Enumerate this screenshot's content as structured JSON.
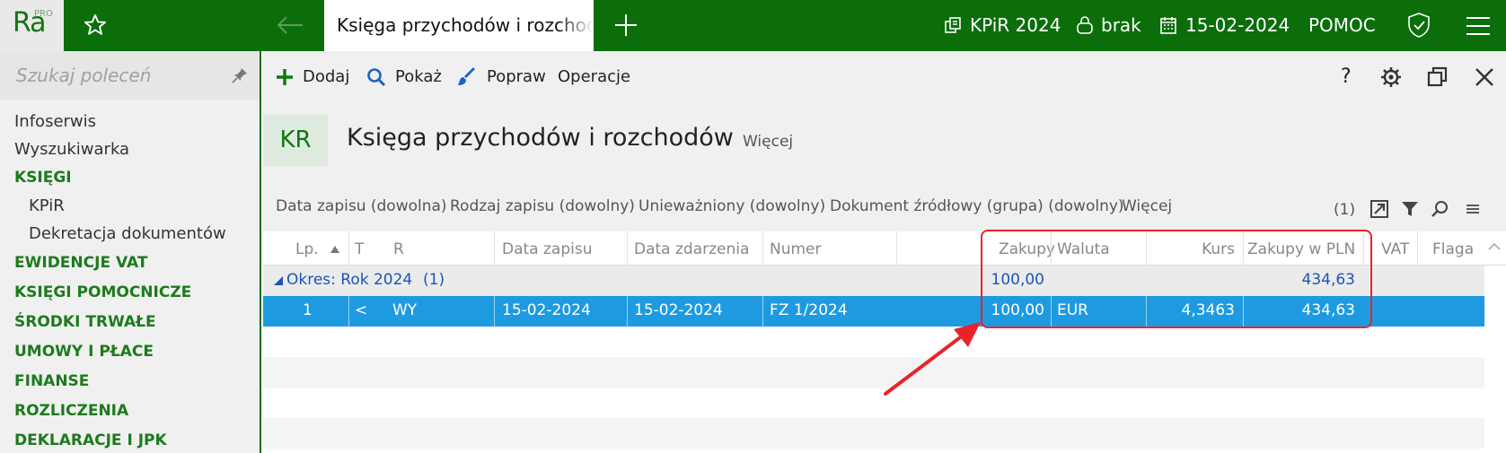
{
  "app": {
    "logo_text": "Ra",
    "logo_badge": "PRO",
    "active_tab": "Księga przychodów i rozchodów",
    "kpir_label": "KPiR 2024",
    "lock_label": "brak",
    "date_label": "15-02-2024",
    "help_label": "POMOC"
  },
  "sidebar": {
    "search_placeholder": "Szukaj poleceń",
    "items": [
      {
        "label": "Infoserwis"
      },
      {
        "label": "Wyszukiwarka"
      },
      {
        "label": "KSIĘGI"
      },
      {
        "label": "KPiR"
      },
      {
        "label": "Dekretacja dokumentów"
      },
      {
        "label": "EWIDENCJE VAT"
      },
      {
        "label": "KSIĘGI POMOCNICZE"
      },
      {
        "label": "ŚRODKI TRWAŁE"
      },
      {
        "label": "UMOWY I PŁACE"
      },
      {
        "label": "FINANSE"
      },
      {
        "label": "ROZLICZENIA"
      },
      {
        "label": "DEKLARACJE I JPK"
      }
    ]
  },
  "toolbar": {
    "add_label": "Dodaj",
    "show_label": "Pokaż",
    "edit_label": "Popraw",
    "ops_label": "Operacje",
    "help_glyph": "?"
  },
  "header": {
    "badge": "KR",
    "title": "Księga przychodów i rozchodów",
    "more": "Więcej"
  },
  "filters": {
    "items": [
      "Data zapisu (dowolna)",
      "Rodzaj zapisu (dowolny)",
      "Unieważniony (dowolny)",
      "Dokument źródłowy (grupa) (dowolny)",
      "Więcej"
    ],
    "count": "(1)"
  },
  "grid": {
    "columns": [
      "Lp.",
      "T",
      "R",
      "Data zapisu",
      "Data zdarzenia",
      "Numer",
      "Zakupy",
      "Waluta",
      "Kurs",
      "Zakupy w PLN",
      "VAT",
      "Flaga"
    ],
    "group": {
      "label": "Okres: Rok 2024",
      "count": "(1)",
      "zakupy": "100,00",
      "zakupy_pln": "434,63"
    },
    "rows": [
      {
        "lp": "1",
        "t": "<",
        "r": "WY",
        "data_zapisu": "15-02-2024",
        "data_zdarzenia": "15-02-2024",
        "numer": "FZ 1/2024",
        "zakupy": "100,00",
        "waluta": "EUR",
        "kurs": "4,3463",
        "zakupy_pln": "434,63",
        "vat": "",
        "flaga": ""
      }
    ]
  },
  "colors": {
    "brand_green": "#0b6e0b",
    "selection_blue": "#1e9be0",
    "group_blue": "#1c55b8",
    "annotation_red": "#e8242a"
  }
}
